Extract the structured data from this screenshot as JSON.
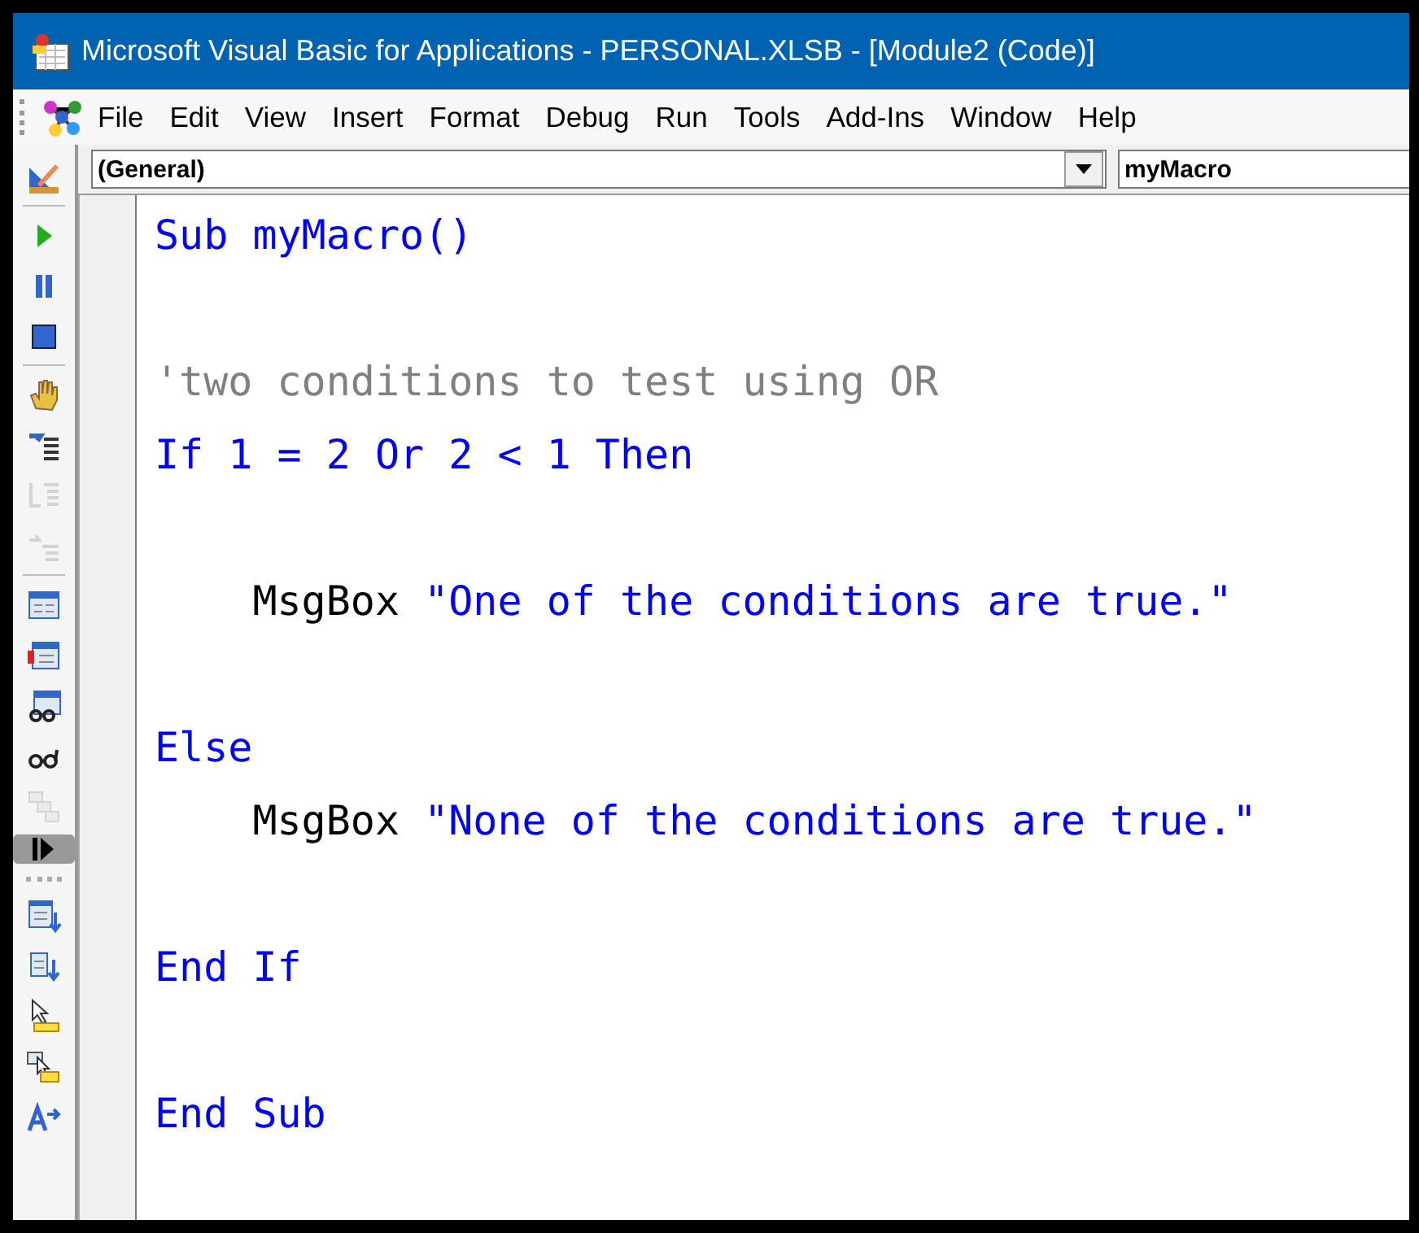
{
  "window": {
    "title": "Microsoft Visual Basic for Applications - PERSONAL.XLSB - [Module2 (Code)]"
  },
  "menu": [
    {
      "label": "File"
    },
    {
      "label": "Edit"
    },
    {
      "label": "View"
    },
    {
      "label": "Insert"
    },
    {
      "label": "Format"
    },
    {
      "label": "Debug"
    },
    {
      "label": "Run"
    },
    {
      "label": "Tools"
    },
    {
      "label": "Add-Ins"
    },
    {
      "label": "Window"
    },
    {
      "label": "Help"
    }
  ],
  "toolbar": [
    {
      "kind": "design",
      "disabled": false
    },
    {
      "kind": "sep"
    },
    {
      "kind": "run",
      "disabled": false
    },
    {
      "kind": "pause",
      "disabled": false
    },
    {
      "kind": "stop",
      "disabled": false
    },
    {
      "kind": "sep"
    },
    {
      "kind": "hand",
      "disabled": false
    },
    {
      "kind": "stepin",
      "disabled": false
    },
    {
      "kind": "stepover",
      "disabled": true
    },
    {
      "kind": "stepout",
      "disabled": true
    },
    {
      "kind": "sep"
    },
    {
      "kind": "window",
      "disabled": false
    },
    {
      "kind": "window-alert",
      "disabled": false
    },
    {
      "kind": "watch",
      "disabled": false
    },
    {
      "kind": "glasses",
      "disabled": false
    },
    {
      "kind": "stack",
      "disabled": true
    },
    {
      "kind": "handle"
    },
    {
      "kind": "grip"
    },
    {
      "kind": "indent-list",
      "disabled": false
    },
    {
      "kind": "outdent",
      "disabled": false
    },
    {
      "kind": "select",
      "disabled": false
    },
    {
      "kind": "select-multi",
      "disabled": false
    },
    {
      "kind": "text-arrow",
      "disabled": false
    }
  ],
  "object_box": {
    "value": "(General)"
  },
  "procedure_box": {
    "value": "myMacro"
  },
  "code": [
    {
      "kind": "code",
      "segments": [
        {
          "kind": "keyword",
          "text": "Sub myMacro()"
        }
      ]
    },
    {
      "kind": "blank"
    },
    {
      "kind": "code",
      "segments": [
        {
          "kind": "comment",
          "text": "'two conditions to test using OR"
        }
      ]
    },
    {
      "kind": "code",
      "segments": [
        {
          "kind": "keyword",
          "text": "If 1 = 2 Or 2 < 1 Then"
        }
      ]
    },
    {
      "kind": "blank"
    },
    {
      "kind": "code",
      "segments": [
        {
          "kind": "plain",
          "text": "    MsgBox "
        },
        {
          "kind": "keyword",
          "text": "\"One of the conditions are true.\""
        }
      ]
    },
    {
      "kind": "blank"
    },
    {
      "kind": "code",
      "segments": [
        {
          "kind": "keyword",
          "text": "Else"
        }
      ]
    },
    {
      "kind": "code",
      "segments": [
        {
          "kind": "plain",
          "text": "    MsgBox "
        },
        {
          "kind": "keyword",
          "text": "\"None of the conditions are true.\""
        }
      ]
    },
    {
      "kind": "blank"
    },
    {
      "kind": "code",
      "segments": [
        {
          "kind": "keyword",
          "text": "End If"
        }
      ]
    },
    {
      "kind": "blank"
    },
    {
      "kind": "code",
      "segments": [
        {
          "kind": "keyword",
          "text": "End Sub"
        }
      ]
    }
  ]
}
